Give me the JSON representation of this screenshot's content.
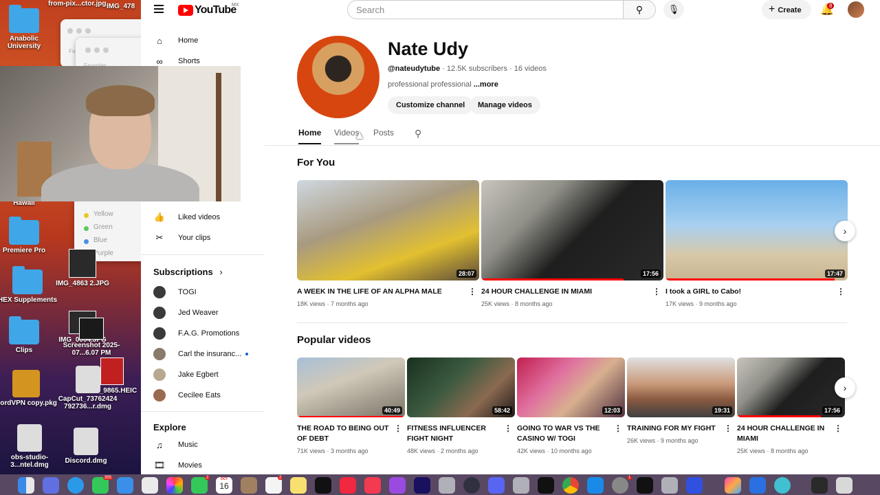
{
  "desktop": {
    "items": [
      {
        "label": "from-pix...ctor.jpg"
      },
      {
        "label": "IMG_478"
      },
      {
        "label": "Anabolic University"
      },
      {
        "label": "Hawaii"
      },
      {
        "label": "Premiere Pro"
      },
      {
        "label": "IMG_4863 2.JPG"
      },
      {
        "label": "HEX Supplements"
      },
      {
        "label": "IMG_0004.JPG"
      },
      {
        "label": "Screenshot 2025-07...6.07 PM"
      },
      {
        "label": "Clips"
      },
      {
        "label": "IMG_9865.HEIC"
      },
      {
        "label": "NordVPN copy.pkg"
      },
      {
        "label": "CapCut_73762424 792736...r.dmg"
      },
      {
        "label": "obs-studio-3...ntel.dmg"
      },
      {
        "label": "Discord.dmg"
      }
    ],
    "finder_tags": [
      "Yellow",
      "Green",
      "Blue",
      "Purple"
    ],
    "finder_labels": [
      "Fa",
      "Favorites"
    ]
  },
  "topbar": {
    "logo": "YouTube",
    "region": "MX",
    "search_placeholder": "Search",
    "create_label": "Create",
    "notification_count": "8"
  },
  "sidebar": {
    "main": [
      {
        "label": "Home",
        "icon": "home-icon"
      },
      {
        "label": "Shorts",
        "icon": "shorts-icon"
      }
    ],
    "you": [
      {
        "label": "Liked videos",
        "icon": "thumbs-up-icon"
      },
      {
        "label": "Your clips",
        "icon": "scissors-icon"
      }
    ],
    "subscriptions_title": "Subscriptions",
    "subscriptions": [
      {
        "label": "TOGI"
      },
      {
        "label": "Jed Weaver"
      },
      {
        "label": "F.A.G. Promotions"
      },
      {
        "label": "Carl the insuranc..."
      },
      {
        "label": "Jake Egbert"
      },
      {
        "label": "Cecilee Eats"
      }
    ],
    "explore_title": "Explore",
    "explore": [
      {
        "label": "Music",
        "icon": "music-icon"
      },
      {
        "label": "Movies",
        "icon": "film-icon"
      }
    ]
  },
  "channel": {
    "name": "Nate Udy",
    "handle": "@nateudytube",
    "subscribers": "12.5K subscribers",
    "video_count": "16 videos",
    "description": "professional professional",
    "more": "...more",
    "customize_label": "Customize channel",
    "manage_label": "Manage videos",
    "tabs": [
      "Home",
      "Videos",
      "Posts"
    ]
  },
  "for_you": {
    "title": "For You",
    "videos": [
      {
        "title": "A WEEK IN THE LIFE OF AN ALPHA MALE",
        "views": "18K views",
        "age": "7 months ago",
        "duration": "28:07"
      },
      {
        "title": "24 HOUR CHALLENGE IN MIAMI",
        "views": "25K views",
        "age": "8 months ago",
        "duration": "17:56"
      },
      {
        "title": "I took a GIRL to Cabo!",
        "views": "17K views",
        "age": "9 months ago",
        "duration": "17:47"
      }
    ]
  },
  "popular": {
    "title": "Popular videos",
    "videos": [
      {
        "title": "THE ROAD TO BEING OUT OF DEBT",
        "views": "71K views",
        "age": "3 months ago",
        "duration": "40:49"
      },
      {
        "title": "FITNESS INFLUENCER FIGHT NIGHT",
        "views": "48K views",
        "age": "2 months ago",
        "duration": "58:42"
      },
      {
        "title": "GOING TO WAR VS THE CASINO W/ TOGI",
        "views": "42K views",
        "age": "10 months ago",
        "duration": "12:03"
      },
      {
        "title": "TRAINING FOR MY FIGHT",
        "views": "26K views",
        "age": "9 months ago",
        "duration": "19:31"
      },
      {
        "title": "24 HOUR CHALLENGE IN MIAMI",
        "views": "25K views",
        "age": "8 months ago",
        "duration": "17:56"
      }
    ]
  },
  "dock": {
    "badges": [
      "355",
      "2",
      "2",
      "1"
    ],
    "calendar_month": "OCT",
    "calendar_day": "16"
  }
}
